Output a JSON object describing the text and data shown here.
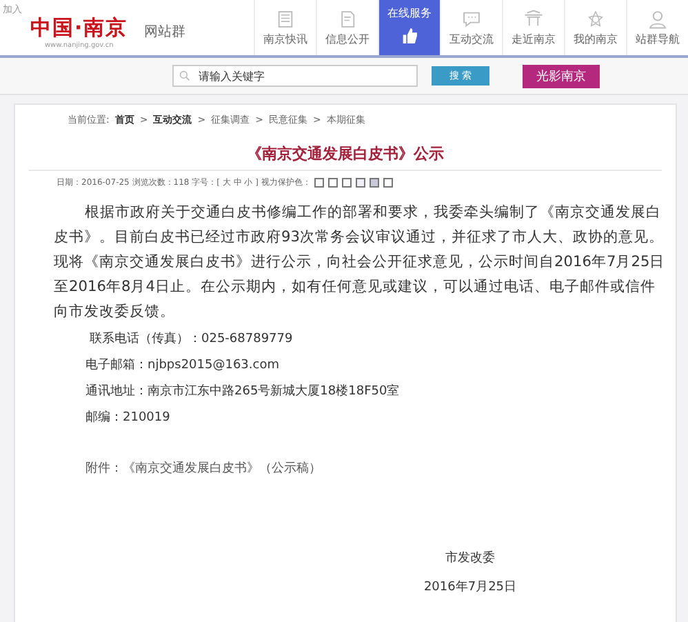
{
  "header": {
    "favorite": "加入",
    "logo": "中国·南京",
    "domain": "www.nanjing.gov.cn",
    "site_group": "网站群",
    "nav": [
      {
        "label": "南京快讯",
        "selected": false
      },
      {
        "label": "信息公开",
        "selected": false
      },
      {
        "label": "在线服务",
        "selected": true
      },
      {
        "label": "互动交流",
        "selected": false
      },
      {
        "label": "走近南京",
        "selected": false
      },
      {
        "label": "我的南京",
        "selected": false
      },
      {
        "label": "站群导航",
        "selected": false
      }
    ]
  },
  "search": {
    "placeholder": "请输入关键字",
    "button": "搜 索",
    "promo": "光影南京"
  },
  "breadcrumb": [
    {
      "label": "当前位置:",
      "kind": "lead"
    },
    {
      "label": "首页",
      "kind": "bold"
    },
    {
      "label": "互动交流",
      "kind": "bold"
    },
    {
      "label": "征集调查",
      "kind": "link"
    },
    {
      "label": "民意征集",
      "kind": "link"
    },
    {
      "label": "本期征集",
      "kind": "link"
    }
  ],
  "separator": ">",
  "article": {
    "title": "《南京交通发展白皮书》公示",
    "meta": "日期：2016-07-25 浏览次数：118 字号：[ 大 中 小 ] 视力保护色：",
    "swatches": [
      {
        "color": "#ffffff"
      },
      {
        "color": "#ffffff"
      },
      {
        "color": "#ffffff"
      },
      {
        "color": "#eeeef4"
      },
      {
        "color": "#c9c9d9"
      },
      {
        "color": "#ffffff"
      }
    ],
    "body": "根据市政府关于交通白皮书修编工作的部署和要求，我委牵头编制了《南京交通发展白皮书》。目前白皮书已经过市政府93次常务会议审议通过，并征求了市人大、政协的意见。现将《南京交通发展白皮书》进行公示，向社会公开征求意见，公示时间自2016年7月25日至2016年8月4日止。在公示期内，如有任何意见或建议，可以通过电话、电子邮件或信件向市发改委反馈。",
    "contacts": [
      "联系电话（传真）：025-68789779",
      "电子邮箱：njbps2015@163.com",
      "通讯地址：南京市江东中路265号新城大厦18楼18F50室",
      "邮编：210019"
    ],
    "attachment": "附件：《南京交通发展白皮书》（公示稿）",
    "signature": "市发改委",
    "date": "2016年7月25日"
  }
}
